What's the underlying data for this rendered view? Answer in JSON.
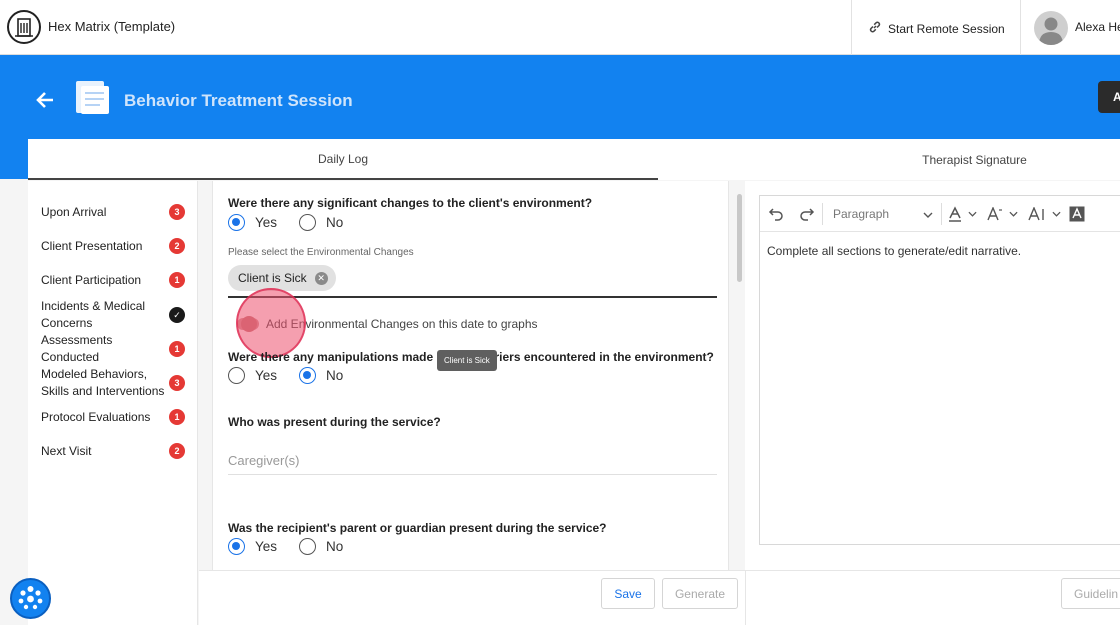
{
  "topbar": {
    "org_name": "Hex Matrix (Template)",
    "remote_session_label": "Start Remote Session",
    "user_name": "Alexa He"
  },
  "header": {
    "title": "Behavior Treatment Session",
    "action_button_label": "A",
    "colors": {
      "brand": "#1282f0"
    }
  },
  "tabs": [
    {
      "label": "Daily Log",
      "active": true
    },
    {
      "label": "Therapist Signature",
      "active": false
    }
  ],
  "nav": [
    {
      "label": "Upon Arrival",
      "badge": "3"
    },
    {
      "label": "Client Presentation",
      "badge": "2"
    },
    {
      "label": "Client Participation",
      "badge": "1"
    },
    {
      "label": "Incidents & Medical Concerns",
      "badge": "✓"
    },
    {
      "label": "Assessments Conducted",
      "badge": "1"
    },
    {
      "label": "Modeled Behaviors, Skills and Interventions",
      "badge": "3"
    },
    {
      "label": "Protocol Evaluations",
      "badge": "1"
    },
    {
      "label": "Next Visit",
      "badge": "2"
    }
  ],
  "form": {
    "q1": "Were there any significant changes to the client's environment?",
    "q1_answer": "Yes",
    "yes_label": "Yes",
    "no_label": "No",
    "env_field_label": "Please select the Environmental Changes",
    "env_chip": "Client is Sick",
    "toggle_label": "Add Environmental Changes on this date to graphs",
    "q2": "Were there any manipulations made due to barriers encountered in the environment?",
    "q2_answer": "No",
    "tooltip": "Client is Sick",
    "q3": "Who was present during the service?",
    "caregiver_placeholder": "Caregiver(s)",
    "q4": "Was the recipient's parent or guardian present during the service?",
    "q4_answer": "Yes"
  },
  "footer": {
    "save_label": "Save",
    "generate_label": "Generate",
    "guidelines_label": "Guidelin"
  },
  "editor": {
    "block_style": "Paragraph",
    "body_text": "Complete all sections to generate/edit narrative."
  }
}
